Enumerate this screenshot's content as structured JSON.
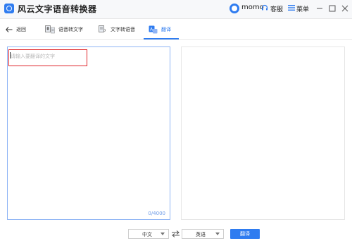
{
  "app": {
    "title": "风云文字语音转换器"
  },
  "account": {
    "username": "momo"
  },
  "header": {
    "support_label": "客服",
    "menu_label": "菜单"
  },
  "toolbar": {
    "back_label": "返回",
    "speech_to_text_label": "语音转文字",
    "text_to_speech_label": "文字转语音",
    "translate_tab_label": "翻译"
  },
  "editor": {
    "source_placeholder": "请输入要翻译的文字",
    "char_count": "0/4000"
  },
  "controls": {
    "source_language": "中文",
    "target_language": "英语",
    "translate_button": "翻译"
  },
  "colors": {
    "accent": "#2f7cf0",
    "highlight": "#e0262b"
  }
}
